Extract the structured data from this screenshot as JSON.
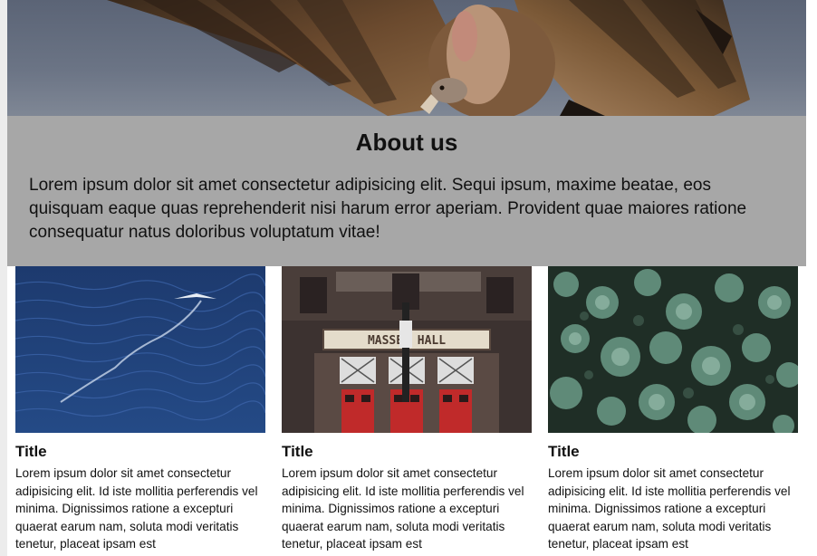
{
  "about": {
    "heading": "About us",
    "text": "Lorem ipsum dolor sit amet consectetur adipisicing elit. Sequi ipsum, maxime beatae, eos quisquam eaque quas reprehenderit nisi harum error aperiam. Provident quae maiores ratione consequatur natus doloribus voluptatum vitae!"
  },
  "cards": [
    {
      "title": "Title",
      "text": "Lorem ipsum dolor sit amet consectetur adipisicing elit. Id iste mollitia perferendis vel minima. Dignissimos ratione a excepturi quaerat earum nam, soluta modi veritatis tenetur, placeat ipsam est"
    },
    {
      "title": "Title",
      "text": "Lorem ipsum dolor sit amet consectetur adipisicing elit. Id iste mollitia perferendis vel minima. Dignissimos ratione a excepturi quaerat earum nam, soluta modi veritatis tenetur, placeat ipsam est",
      "sign_text": "MASSEY HALL"
    },
    {
      "title": "Title",
      "text": "Lorem ipsum dolor sit amet consectetur adipisicing elit. Id iste mollitia perferendis vel minima. Dignissimos ratione a excepturi quaerat earum nam, soluta modi veritatis tenetur, placeat ipsam est"
    }
  ],
  "colors": {
    "about_background": "#a7a7a7",
    "page_background": "#ffffff"
  }
}
